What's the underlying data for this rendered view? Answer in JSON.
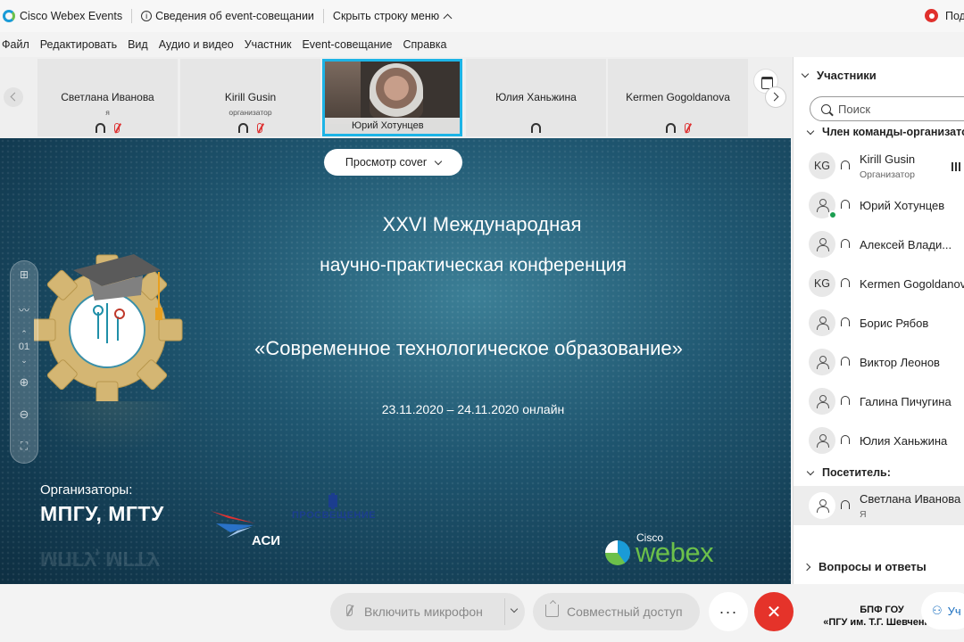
{
  "titlebar": {
    "app_name": "Cisco Webex Events",
    "event_info": "Сведения об event-совещании",
    "hide_menu": "Скрыть строку меню",
    "recording": "Под"
  },
  "menu": [
    "Файл",
    "Редактировать",
    "Вид",
    "Аудио и видео",
    "Участник",
    "Event-совещание",
    "Справка"
  ],
  "strip": {
    "tiles": [
      {
        "name": "Светлана Иванова",
        "role": "я"
      },
      {
        "name": "Kirill Gusin",
        "role": "организатор"
      },
      {
        "name": "Юрий Хотунцев",
        "role": ""
      },
      {
        "name": "Юлия Ханьжина",
        "role": ""
      },
      {
        "name": "Kermen Gogoldanova",
        "role": ""
      }
    ]
  },
  "stage": {
    "view_button": "Просмотр cover",
    "line1": "XXVI Международная",
    "line2": "научно-практическая конференция",
    "line3": "«Современное технологическое образование»",
    "dates": "23.11.2020 – 24.11.2020 онлайн",
    "organizers_label": "Организаторы:",
    "organizers": "МПГУ,  МГТУ",
    "asi": "АСИ",
    "prosveshchenie": "ПРОСВЕЩЕНИЕ",
    "cisco": "Cisco",
    "webex": "webex",
    "page_number": "01"
  },
  "panel": {
    "title": "Участники",
    "search_placeholder": "Поиск",
    "group_hosts": "Член команды-организатора",
    "group_attendees": "Посетитель:",
    "hosts": [
      {
        "initials": "KG",
        "name": "Kirill Gusin",
        "sub": "Организатор"
      },
      {
        "initials": "",
        "name": "Юрий Хотунцев",
        "sub": ""
      },
      {
        "initials": "",
        "name": "Алексей Влади...",
        "sub": ""
      },
      {
        "initials": "KG",
        "name": "Kermen Gogoldanova",
        "sub": ""
      },
      {
        "initials": "",
        "name": "Борис Рябов",
        "sub": ""
      },
      {
        "initials": "",
        "name": "Виктор Леонов",
        "sub": ""
      },
      {
        "initials": "",
        "name": "Галина Пичугина",
        "sub": ""
      },
      {
        "initials": "",
        "name": "Юлия Ханьжина",
        "sub": ""
      }
    ],
    "attendees": [
      {
        "initials": "",
        "name": "Светлана Иванова",
        "sub": "Я"
      }
    ],
    "qa": "Вопросы и ответы"
  },
  "bottom": {
    "mic": "Включить микрофон",
    "share": "Совместный доступ",
    "more": "···",
    "end": "✕",
    "users": "Уч",
    "watermark_line1": "БПФ ГОУ",
    "watermark_line2": "«ПГУ им. Т.Г. Шевченко»"
  },
  "colors": {
    "accent": "#1db4e6",
    "end_call": "#e5332a",
    "webex_green": "#6cc04a",
    "stage_bg": "#1f5670"
  }
}
